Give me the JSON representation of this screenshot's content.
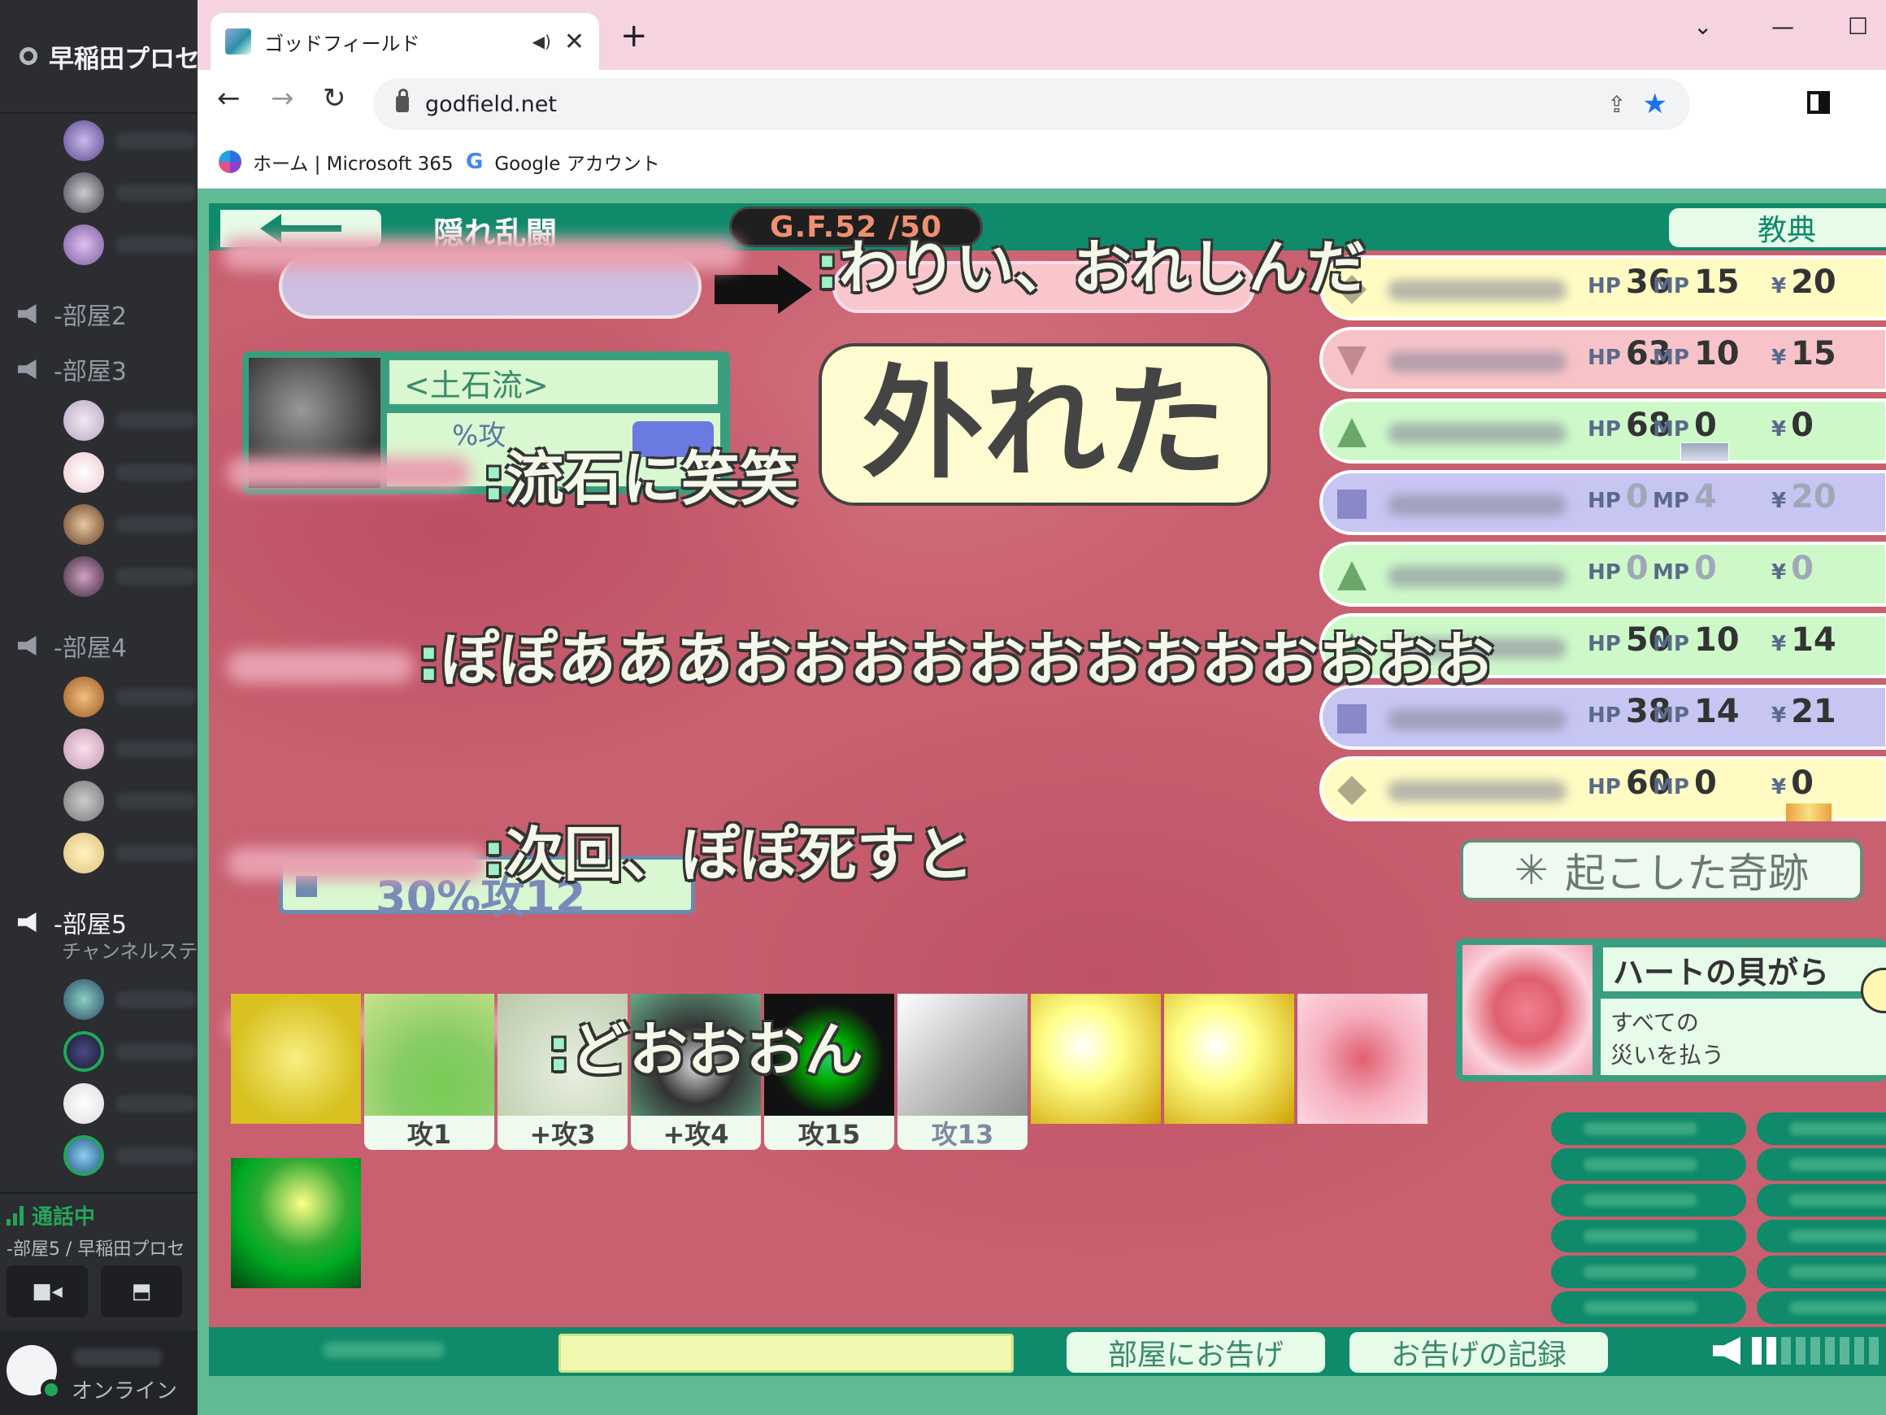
{
  "discord": {
    "server_name": "早稲田プロセ",
    "channels": [
      "-部屋2",
      "-部屋3",
      "-部屋4",
      "-部屋5"
    ],
    "channel_sub": "チャンネルステ",
    "voice": {
      "status": "通話中",
      "location": "-部屋5 / 早稲田プロセ"
    },
    "user": {
      "status": "オンライン"
    }
  },
  "browser": {
    "tab_title": "ゴッドフィールド",
    "url": "godfield.net",
    "bookmarks": [
      "ホーム | Microsoft 365",
      "Google アカウント"
    ]
  },
  "game": {
    "rule_name": "隠れ乱闘",
    "gf_counter": "G.F.52 /50",
    "handbook_btn": "教典",
    "players": [
      {
        "mark": "diamond",
        "color": "yellow",
        "hp": "36",
        "mp": "15",
        "yen": "20"
      },
      {
        "mark": "inverted-triangle",
        "color": "pink",
        "hp": "63",
        "mp": "10",
        "yen": "15"
      },
      {
        "mark": "triangle",
        "color": "green",
        "hp": "68",
        "mp": "0",
        "yen": "0"
      },
      {
        "mark": "square",
        "color": "blue",
        "hp": "0",
        "mp": "4",
        "yen": "20"
      },
      {
        "mark": "triangle",
        "color": "green",
        "hp": "0",
        "mp": "0",
        "yen": "0"
      },
      {
        "mark": "triangle",
        "color": "green",
        "hp": "50",
        "mp": "10",
        "yen": "14"
      },
      {
        "mark": "square",
        "color": "blue",
        "hp": "38",
        "mp": "14",
        "yen": "21"
      },
      {
        "mark": "diamond",
        "color": "yellow",
        "hp": "60",
        "mp": "0",
        "yen": "0"
      }
    ],
    "labels": {
      "hp": "HP",
      "mp": "MP",
      "yen": "¥"
    },
    "miracle_btn": "起こした奇跡",
    "miracle_icon": "✳",
    "left_card": {
      "name": "<土石流>",
      "effect_partial": "%攻"
    },
    "speech": "外れた",
    "chats": [
      "わりい、おれしんだ",
      "流石に笑笑",
      "ぽぽあああおおおおおおおおおおおおお",
      "次回、ぽぽ死すと",
      "どおおおん"
    ],
    "background_text": "30%攻12",
    "card_detail": {
      "name": "ハートの貝がら",
      "desc_line1": "すべての",
      "desc_line2": "災いを払う"
    },
    "hand": [
      {
        "label": ""
      },
      {
        "label": "攻1"
      },
      {
        "label": "+攻3"
      },
      {
        "label": "+攻4"
      },
      {
        "label": "攻15"
      },
      {
        "label": "攻13"
      },
      {
        "label": ""
      },
      {
        "label": ""
      },
      {
        "label": ""
      }
    ],
    "bottom": {
      "announce_btn": "部屋にお告げ",
      "log_btn": "お告げの記録"
    },
    "volume_level": 2,
    "colors": {
      "board": "#c8606f",
      "frame": "#0f8a6a",
      "panel": "#e6fbe8"
    }
  }
}
